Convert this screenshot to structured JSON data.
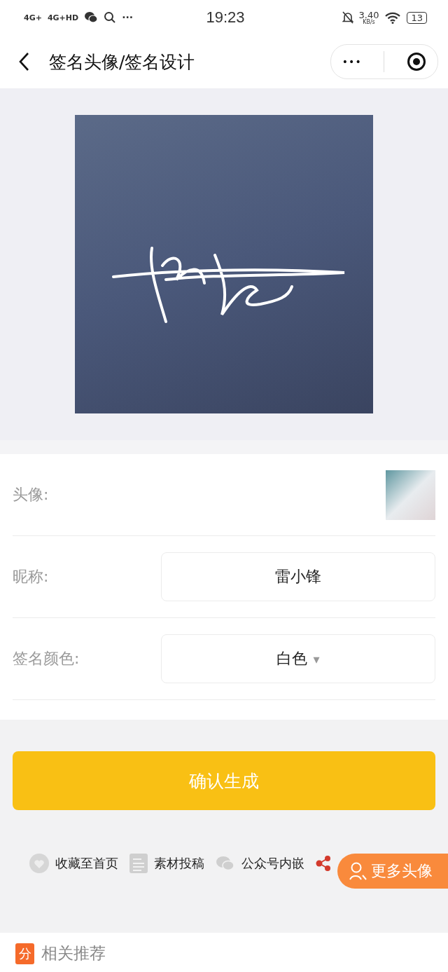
{
  "status_bar": {
    "network_1": "4G+",
    "network_2": "4G+HD",
    "more": "···",
    "time": "19:23",
    "speed": "3.40",
    "speed_unit": "KB/s",
    "battery": "13"
  },
  "nav": {
    "title": "签名头像/签名设计",
    "more": "•••"
  },
  "form": {
    "rows": [
      {
        "kind": "avatar",
        "label": "头像:"
      },
      {
        "kind": "input",
        "label": "昵称:",
        "value": "雷小锋"
      },
      {
        "kind": "select",
        "label": "签名颜色:",
        "value": "白色",
        "caret": "▾"
      }
    ]
  },
  "confirm_button": "确认生成",
  "actions": [
    {
      "kind": "heart",
      "label": "收藏至首页"
    },
    {
      "kind": "doc",
      "label": "素材投稿"
    },
    {
      "kind": "wechat",
      "label": "公众号内嵌"
    },
    {
      "kind": "share"
    }
  ],
  "float_button": "更多头像",
  "related": {
    "badge": "分",
    "title": "相关推荐"
  }
}
